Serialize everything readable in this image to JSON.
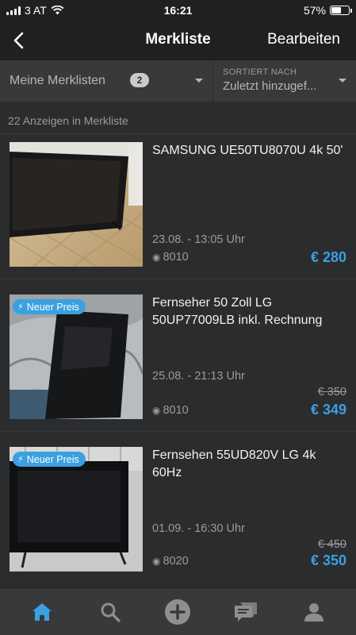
{
  "status_bar": {
    "carrier": "3 AT",
    "time": "16:21",
    "battery": "57%",
    "battery_level": 0.57
  },
  "nav": {
    "title": "Merkliste",
    "edit_label": "Bearbeiten"
  },
  "filter": {
    "lists_label": "Meine Merklisten",
    "lists_count": "2",
    "sort_caption": "SORTIERT NACH",
    "sort_value": "Zuletzt hinzugef..."
  },
  "count_text": "22 Anzeigen in Merkliste",
  "listings": [
    {
      "title": "SAMSUNG UE50TU8070U 4k 50'",
      "date": "23.08. - 13:05 Uhr",
      "location": "8010",
      "price": "€ 280",
      "old_price": "",
      "tag": ""
    },
    {
      "title": "Fernseher 50 Zoll LG 50UP77009LB inkl. Rechnung",
      "date": "25.08. - 21:13 Uhr",
      "location": "8010",
      "price": "€ 349",
      "old_price": "€ 350",
      "tag": "Neuer Preis"
    },
    {
      "title": "Fernsehen 55UD820V LG 4k 60Hz",
      "date": "01.09. - 16:30 Uhr",
      "location": "8020",
      "price": "€ 350",
      "old_price": "€ 450",
      "tag": "Neuer Preis"
    }
  ],
  "tabs": [
    {
      "icon": "home-icon",
      "active": true
    },
    {
      "icon": "search-icon",
      "active": false
    },
    {
      "icon": "add-icon",
      "active": false
    },
    {
      "icon": "messages-icon",
      "active": false
    },
    {
      "icon": "profile-icon",
      "active": false
    }
  ],
  "colors": {
    "accent": "#3aa0e0",
    "background": "#2b2c2e",
    "bar": "#1f2021",
    "inactive_icon": "#8e8f91"
  }
}
